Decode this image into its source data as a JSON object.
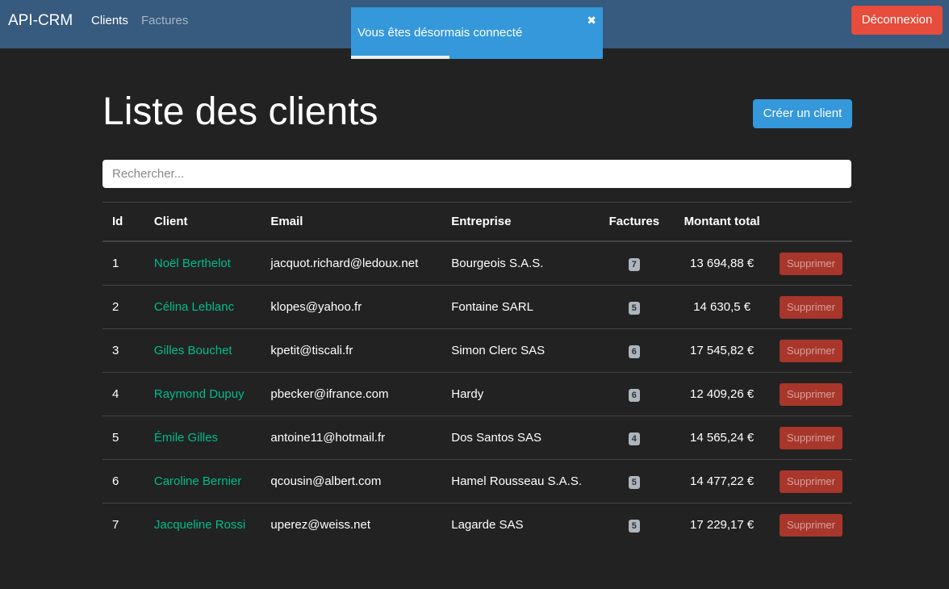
{
  "navbar": {
    "brand": "API-CRM",
    "links": [
      {
        "label": "Clients",
        "active": true
      },
      {
        "label": "Factures",
        "active": false
      }
    ],
    "logout_label": "Déconnexion"
  },
  "toast": {
    "message": "Vous êtes désormais connecté",
    "close_icon": "✖",
    "progress": 0.39
  },
  "page": {
    "title": "Liste des clients",
    "create_label": "Créer un client"
  },
  "search": {
    "placeholder": "Rechercher..."
  },
  "table": {
    "headers": [
      "Id",
      "Client",
      "Email",
      "Entreprise",
      "Factures",
      "Montant total",
      ""
    ],
    "delete_label": "Supprimer",
    "rows": [
      {
        "id": "1",
        "client": "Noël Berthelot",
        "email": "jacquot.richard@ledoux.net",
        "company": "Bourgeois S.A.S.",
        "invoices": "7",
        "amount": "13 694,88 €"
      },
      {
        "id": "2",
        "client": "Célina Leblanc",
        "email": "klopes@yahoo.fr",
        "company": "Fontaine SARL",
        "invoices": "5",
        "amount": "14 630,5 €"
      },
      {
        "id": "3",
        "client": "Gilles Bouchet",
        "email": "kpetit@tiscali.fr",
        "company": "Simon Clerc SAS",
        "invoices": "6",
        "amount": "17 545,82 €"
      },
      {
        "id": "4",
        "client": "Raymond Dupuy",
        "email": "pbecker@ifrance.com",
        "company": "Hardy",
        "invoices": "6",
        "amount": "12 409,26 €"
      },
      {
        "id": "5",
        "client": "Émile Gilles",
        "email": "antoine11@hotmail.fr",
        "company": "Dos Santos SAS",
        "invoices": "4",
        "amount": "14 565,24 €"
      },
      {
        "id": "6",
        "client": "Caroline Bernier",
        "email": "qcousin@albert.com",
        "company": "Hamel Rousseau S.A.S.",
        "invoices": "5",
        "amount": "14 477,22 €"
      },
      {
        "id": "7",
        "client": "Jacqueline Rossi",
        "email": "uperez@weiss.net",
        "company": "Lagarde SAS",
        "invoices": "5",
        "amount": "17 229,17 €"
      }
    ]
  },
  "colors": {
    "navbar": "#375a7f",
    "background": "#222222",
    "accent": "#3498db",
    "danger": "#e74c3c",
    "link": "#00bc8c"
  }
}
